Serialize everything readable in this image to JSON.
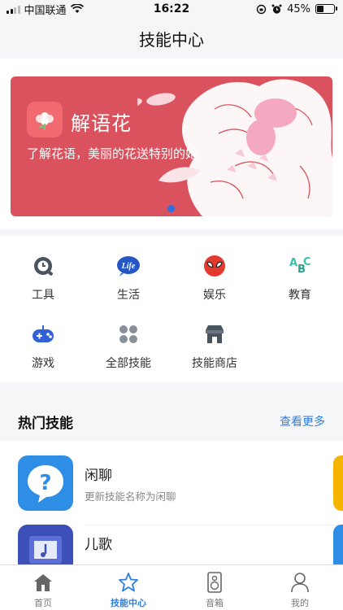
{
  "status_bar": {
    "carrier": "中国联通",
    "time": "16:22",
    "battery": "45%",
    "battery_level": 0.45
  },
  "header": {
    "title": "技能中心"
  },
  "banner": {
    "title": "解语花",
    "subtitle": "了解花语，美丽的花送特别的她",
    "accent_color": "#d9525d",
    "page_count": 1,
    "active_page": 1
  },
  "categories": [
    {
      "label": "工具",
      "icon": "tool-clock-icon"
    },
    {
      "label": "生活",
      "icon": "life-icon"
    },
    {
      "label": "娱乐",
      "icon": "spiderman-mask-icon"
    },
    {
      "label": "教育",
      "icon": "abc-icon"
    },
    {
      "label": "游戏",
      "icon": "gamepad-icon"
    },
    {
      "label": "全部技能",
      "icon": "grid-dots-icon"
    },
    {
      "label": "技能商店",
      "icon": "store-icon"
    }
  ],
  "hot_skills": {
    "title": "热门技能",
    "more_label": "查看更多",
    "items": [
      {
        "name": "闲聊",
        "description": "更新技能名称为闲聊",
        "icon": "question-bubble-icon"
      },
      {
        "name": "儿歌",
        "description": "",
        "icon": "music-book-icon"
      }
    ]
  },
  "tabbar": {
    "items": [
      {
        "label": "首页",
        "icon": "home-icon",
        "active": false
      },
      {
        "label": "技能中心",
        "icon": "star-icon",
        "active": true
      },
      {
        "label": "音箱",
        "icon": "speaker-icon",
        "active": false
      },
      {
        "label": "我的",
        "icon": "user-icon",
        "active": false
      }
    ],
    "active_color": "#2f7fe0"
  }
}
